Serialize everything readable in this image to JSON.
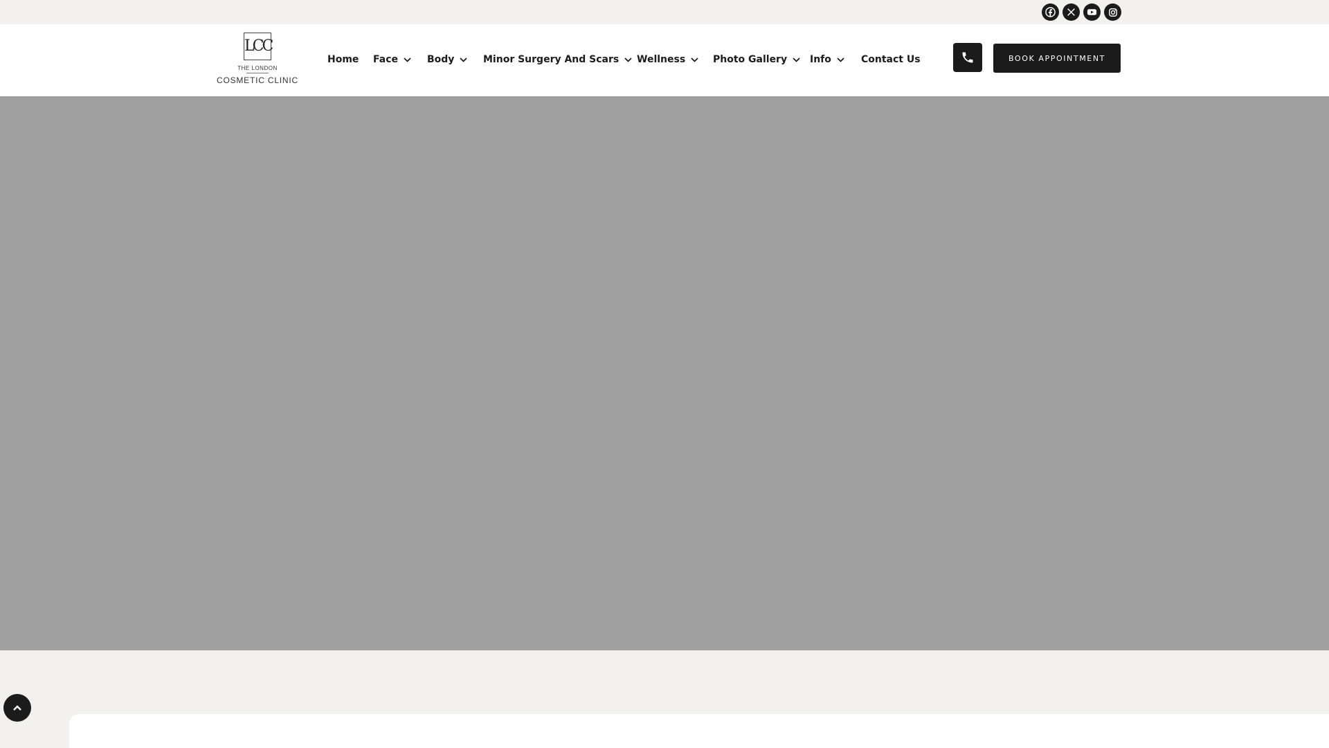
{
  "brand": {
    "monogram": "LCC",
    "line1": "THE LONDON",
    "line2": "COSMETIC CLINIC"
  },
  "social": [
    {
      "icon": "facebook-icon"
    },
    {
      "icon": "x-twitter-icon"
    },
    {
      "icon": "youtube-icon"
    },
    {
      "icon": "instagram-icon"
    }
  ],
  "nav": {
    "items": [
      {
        "label": "Home",
        "dropdown": false
      },
      {
        "label": "Face",
        "dropdown": true
      },
      {
        "label": "Body",
        "dropdown": true
      },
      {
        "label": "Minor Surgery And Scars",
        "dropdown": true
      },
      {
        "label": "Wellness",
        "dropdown": true
      },
      {
        "label": "Photo Gallery",
        "dropdown": true
      },
      {
        "label": "Info",
        "dropdown": true
      },
      {
        "label": "Contact Us",
        "dropdown": false
      }
    ]
  },
  "cta": {
    "book_label": "BOOK APPOINTMENT"
  },
  "colors": {
    "dark": "#1b1b1b",
    "hero": "#a0a0a0",
    "background": "#f2f1ef"
  }
}
